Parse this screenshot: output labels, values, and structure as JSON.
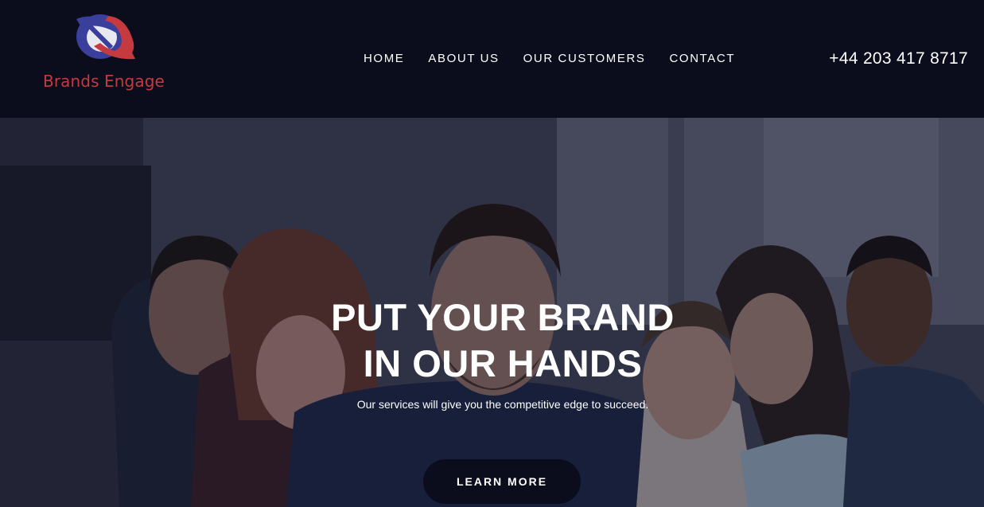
{
  "brand": {
    "name": "Brands Engage",
    "logo_icon": "brands-engage-logo-icon",
    "primary_color": "#c53a3e",
    "secondary_color": "#3b3f9c"
  },
  "nav": {
    "items": [
      {
        "label": "HOME"
      },
      {
        "label": "ABOUT US"
      },
      {
        "label": "OUR CUSTOMERS"
      },
      {
        "label": "CONTACT"
      }
    ]
  },
  "header": {
    "phone": "+44 203 417 8717",
    "background": "#0b0d1c"
  },
  "hero": {
    "title_line1": "PUT YOUR BRAND",
    "title_line2": "IN OUR HANDS",
    "subtitle": "Our services will give you the competitive edge to succeed.",
    "cta_label": "LEARN MORE",
    "image": "team-photo"
  }
}
